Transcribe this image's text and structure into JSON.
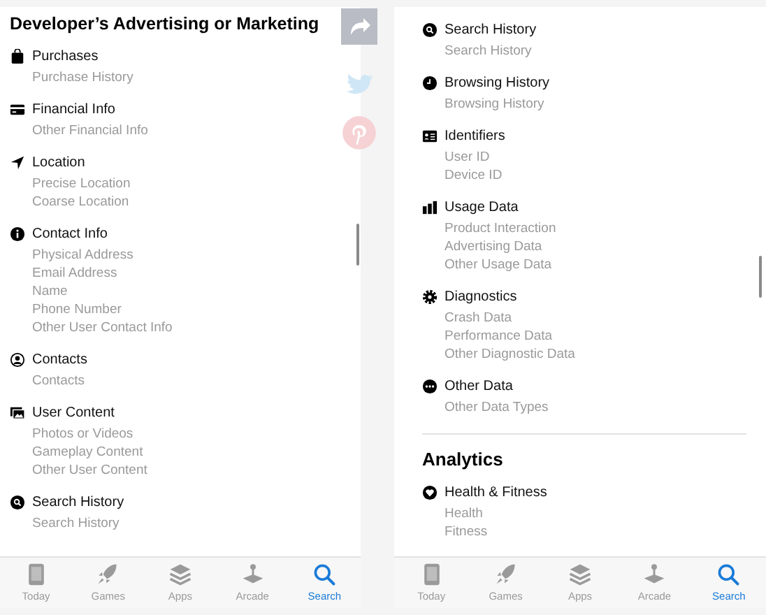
{
  "panels": [
    {
      "heading": "Developer’s Advertising or Marketing",
      "categories": [
        {
          "kind": "bag",
          "title": "Purchases",
          "items": [
            "Purchase History"
          ]
        },
        {
          "kind": "card",
          "title": "Financial Info",
          "items": [
            "Other Financial Info"
          ]
        },
        {
          "kind": "location",
          "title": "Location",
          "items": [
            "Precise Location",
            "Coarse Location"
          ]
        },
        {
          "kind": "info",
          "title": "Contact Info",
          "items": [
            "Physical Address",
            "Email Address",
            "Name",
            "Phone Number",
            "Other User Contact Info"
          ]
        },
        {
          "kind": "person",
          "title": "Contacts",
          "items": [
            "Contacts"
          ]
        },
        {
          "kind": "photos",
          "title": "User Content",
          "items": [
            "Photos or Videos",
            "Gameplay Content",
            "Other User Content"
          ]
        },
        {
          "kind": "search",
          "title": "Search History",
          "items": [
            "Search History"
          ]
        }
      ],
      "tabs": [
        {
          "kind": "today",
          "label": "Today",
          "selected": false
        },
        {
          "kind": "games",
          "label": "Games",
          "selected": false
        },
        {
          "kind": "apps",
          "label": "Apps",
          "selected": false
        },
        {
          "kind": "arcade",
          "label": "Arcade",
          "selected": false
        },
        {
          "kind": "search",
          "label": "Search",
          "selected": true
        }
      ]
    },
    {
      "categories": [
        {
          "kind": "search",
          "title": "Search History",
          "items": [
            "Search History"
          ]
        },
        {
          "kind": "clock",
          "title": "Browsing History",
          "items": [
            "Browsing History"
          ]
        },
        {
          "kind": "idcard",
          "title": "Identifiers",
          "items": [
            "User ID",
            "Device ID"
          ]
        },
        {
          "kind": "bars",
          "title": "Usage Data",
          "items": [
            "Product Interaction",
            "Advertising Data",
            "Other Usage Data"
          ]
        },
        {
          "kind": "gear",
          "title": "Diagnostics",
          "items": [
            "Crash Data",
            "Performance Data",
            "Other Diagnostic Data"
          ]
        },
        {
          "kind": "ellipsis",
          "title": "Other Data",
          "items": [
            "Other Data Types"
          ]
        }
      ],
      "section": {
        "heading": "Analytics",
        "categories": [
          {
            "kind": "heart",
            "title": "Health & Fitness",
            "items": [
              "Health",
              "Fitness"
            ]
          }
        ]
      },
      "tabs": [
        {
          "kind": "today",
          "label": "Today",
          "selected": false
        },
        {
          "kind": "games",
          "label": "Games",
          "selected": false
        },
        {
          "kind": "apps",
          "label": "Apps",
          "selected": false
        },
        {
          "kind": "arcade",
          "label": "Arcade",
          "selected": false
        },
        {
          "kind": "search",
          "label": "Search",
          "selected": true
        }
      ]
    }
  ]
}
